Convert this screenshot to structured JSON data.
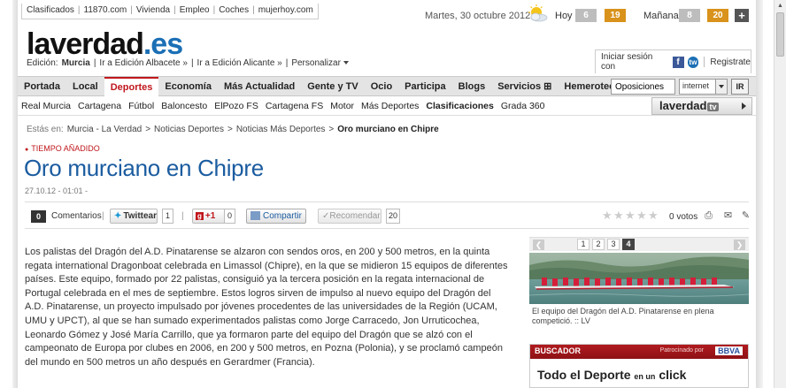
{
  "toplinks": [
    "Clasificados",
    "11870.com",
    "Vivienda",
    "Empleo",
    "Coches",
    "mujerhoy.com"
  ],
  "weather": {
    "date": "Martes, 30 octubre 2012",
    "today_label": "Hoy",
    "today_min": "6",
    "today_max": "19",
    "tomorrow_label": "Mañana",
    "tomorrow_min": "8",
    "tomorrow_max": "20",
    "more": "+",
    "icon": "sun-cloud-icon"
  },
  "logo": {
    "main": "laverdad",
    "ext": ".es"
  },
  "edition": {
    "label": "Edición:",
    "current": "Murcia",
    "albacete": "Ir a Edición Albacete »",
    "alicante": "Ir a Edición Alicante »",
    "personalize": "Personalizar"
  },
  "login": {
    "label": "Iniciar sesión con",
    "register": "Registrate"
  },
  "mainnav": [
    "Portada",
    "Local",
    "Deportes",
    "Economía",
    "Más Actualidad",
    "Gente y TV",
    "Ocio",
    "Participa",
    "Blogs",
    "Servicios ⊞",
    "Hemeroteca"
  ],
  "mainnav_active": "Deportes",
  "search": {
    "value": "Oposiciones",
    "scope": "internet",
    "button": "IR"
  },
  "subnav": [
    "Real Murcia",
    "Cartagena",
    "Fútbol",
    "Baloncesto",
    "ElPozo FS",
    "Cartagena FS",
    "Motor",
    "Más Deportes",
    "Clasificaciones",
    "Grada 360"
  ],
  "subnav_strong": "Clasificaciones",
  "tv": {
    "label": "laverdad",
    "badge": "tv"
  },
  "breadcrumb": {
    "label": "Estás en:",
    "items": [
      "Murcia - La Verdad",
      "Noticias Deportes",
      "Noticias Más Deportes"
    ],
    "current": "Oro murciano en Chipre"
  },
  "article": {
    "section": "TIEMPO AÑADIDO",
    "title": "Oro murciano en Chipre",
    "stamp": "27.10.12 - 01:01 -",
    "paragraphs": [
      "Los palistas del Dragón del A.D. Pinatarense se alzaron con sendos oros, en 200 y 500 metros, en la quinta regata international Dragonboat celebrada en Limassol (Chipre), en la que se midieron 15 equipos de diferentes países. Este equipo, formado por 22 palistas, consiguió ya la tercera posición en la regata internacional de Portugal celebrada en el mes de septiembre. Estos logros sirven de impulso al nuevo equipo del Dragón del A.D. Pinatarense, un proyecto impulsado por jóvenes procedentes de las universidades de la Región (UCAM, UMU y UPCT), al que se han sumado experimentados palistas como Jorge Carracedo, Jon Urruticochea, Leonardo Gómez y José María Carrillo, que ya formaron parte del equipo del Dragón que se alzó con el campeonato de Europa por clubes en 2006, en 200 y 500 metros, en Pozna (Polonia), y se proclamó campeón del mundo en 500 metros un año después en Gerardmer (Francia)."
    ]
  },
  "social": {
    "comments_count": "0",
    "comments_label": "Comentarios",
    "twitter_label": "Twittear",
    "twitter_count": "1",
    "gplus_label": "+1",
    "gplus_count": "0",
    "share_label": "Compartir",
    "recommend_label": "Recomendar",
    "recommend_count": "20",
    "votes": "0 votos",
    "rating": 0
  },
  "gallery": {
    "pages": [
      "1",
      "2",
      "3",
      "4"
    ],
    "current": "4",
    "caption": "El equipo del Dragón del A.D. Pinatarense en plena competició. :: LV"
  },
  "ad": {
    "title": "BUSCADOR",
    "sponsor": "Patrocinado por",
    "sponsor_brand": "BBVA",
    "text_a": "Todo el Deporte",
    "text_b": "en un",
    "text_c": "click"
  },
  "colors": {
    "brand_blue": "#1b6fb5",
    "accent_red": "#c0171c",
    "max_temp": "#d9921b"
  }
}
